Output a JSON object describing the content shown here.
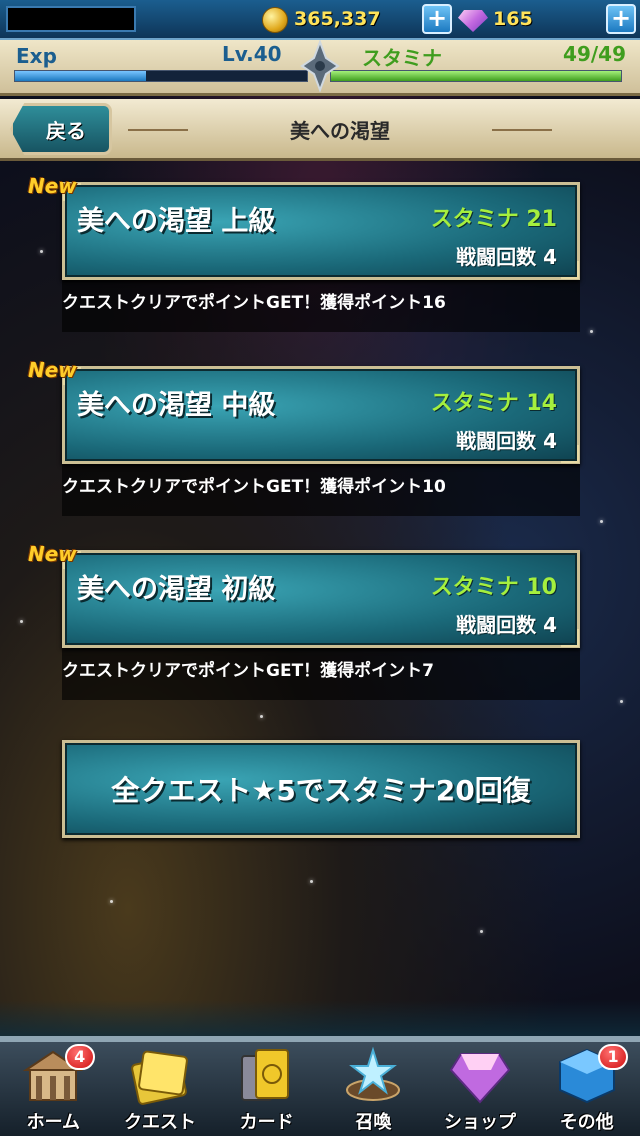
{
  "topbar": {
    "gold": "365,337",
    "gems": "165",
    "plus_label": "+"
  },
  "status": {
    "exp_label": "Exp",
    "level": "Lv.40",
    "stamina_label": "スタミナ",
    "stamina_value": "49/49",
    "exp_progress": 0.45,
    "stamina_progress": 1.0
  },
  "header": {
    "back_label": "戻る",
    "title": "美への渇望"
  },
  "quests": [
    {
      "badge": "New",
      "title": "美への渇望 上級",
      "stamina": "スタミナ 21",
      "battles": "戦闘回数 4",
      "description": "クエストクリアでポイントGET！獲得ポイント16"
    },
    {
      "badge": "New",
      "title": "美への渇望 中級",
      "stamina": "スタミナ 14",
      "battles": "戦闘回数 4",
      "description": "クエストクリアでポイントGET！獲得ポイント10"
    },
    {
      "badge": "New",
      "title": "美への渇望 初級",
      "stamina": "スタミナ 10",
      "battles": "戦闘回数 4",
      "description": "クエストクリアでポイントGET！獲得ポイント7"
    }
  ],
  "recover_button": "全クエスト★5でスタミナ20回復",
  "nav": [
    {
      "label": "ホーム",
      "badge": "4",
      "icon": "home-icon"
    },
    {
      "label": "クエスト",
      "icon": "quest-icon"
    },
    {
      "label": "カード",
      "icon": "card-icon"
    },
    {
      "label": "召喚",
      "icon": "summon-icon"
    },
    {
      "label": "ショップ",
      "icon": "shop-icon"
    },
    {
      "label": "その他",
      "badge": "1",
      "icon": "other-icon"
    }
  ],
  "colors": {
    "accent_teal": "#1a6878",
    "stamina_green": "#a5ef3e",
    "gold_text": "#ffe35a",
    "new_badge": "#ffcd2a"
  }
}
